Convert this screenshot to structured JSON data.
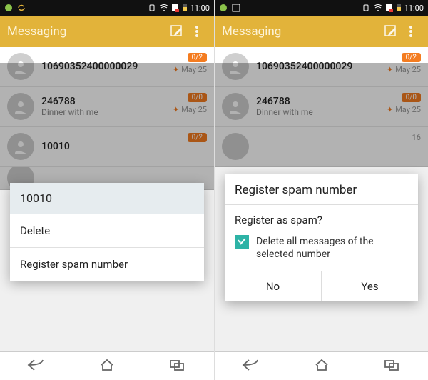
{
  "status": {
    "time": "11:00"
  },
  "app": {
    "title": "Messaging"
  },
  "conversations": [
    {
      "title": "10690352400000029",
      "snippet": "",
      "badge": "0/2",
      "date": "May 25"
    },
    {
      "title": "246788",
      "snippet": "Dinner with me",
      "badge": "0/0",
      "date": "May 25"
    },
    {
      "title": "10010",
      "snippet": "",
      "badge": "0/2",
      "date": ""
    },
    {
      "title": "",
      "snippet": "",
      "badge": "",
      "date": "16"
    }
  ],
  "contextMenu": {
    "header": "10010",
    "items": [
      "Delete",
      "Register spam number"
    ]
  },
  "dialog": {
    "title": "Register spam number",
    "question": "Register as spam?",
    "checkboxLabel": "Delete all messages of the selected number",
    "no": "No",
    "yes": "Yes"
  }
}
